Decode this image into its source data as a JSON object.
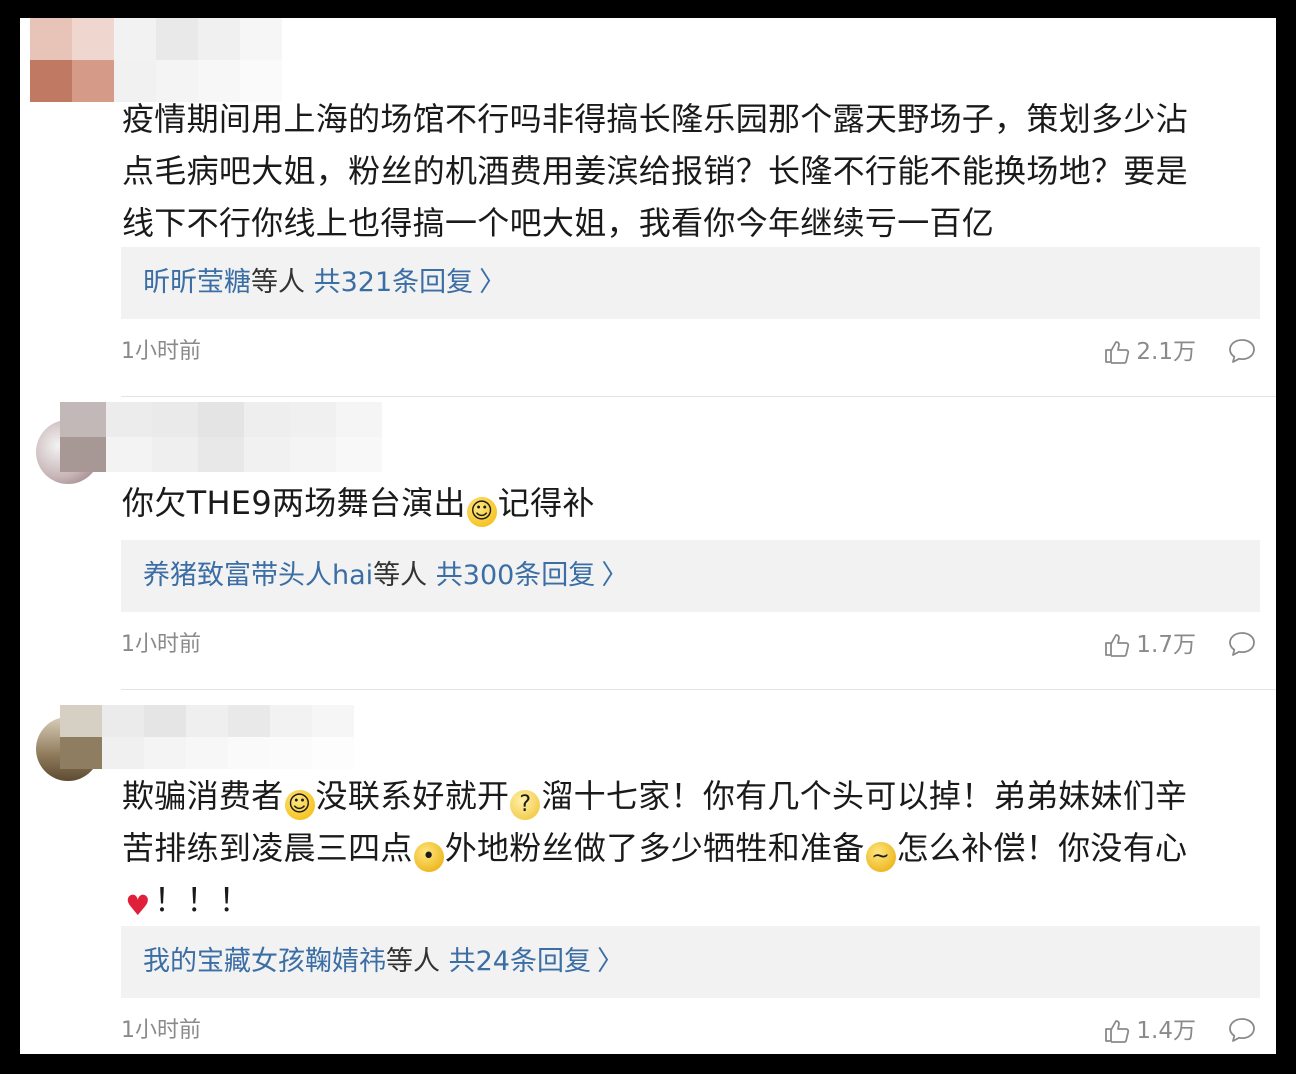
{
  "comments": [
    {
      "text_lines": [
        "疫情期间用上海的场馆不行吗非得搞长隆乐园那个露天野场子，策划多少沾",
        "点毛病吧大姐，粉丝的机酒费用姜滨给报销？长隆不行能不能换场地？要是",
        "线下不行你线上也得搞一个吧大姐，我看你今年继续亏一百亿"
      ],
      "reply_user": "昕昕莹糖",
      "reply_suffix": "等人",
      "reply_count": "共321条回复",
      "time": "1小时前",
      "likes": "2.1万"
    },
    {
      "text_a": "你欠THE9两场舞台演出",
      "text_b": "记得补",
      "reply_user": "养猪致富带头人hai",
      "reply_suffix": "等人",
      "reply_count": "共300条回复",
      "time": "1小时前",
      "likes": "1.7万"
    },
    {
      "text_1a": "欺骗消费者",
      "text_1b": "没联系好就开",
      "text_1c": "溜十七家！你有几个头可以掉！弟弟妹妹们辛",
      "text_2a": "苦排练到凌晨三四点",
      "text_2b": "外地粉丝做了多少牺牲和准备",
      "text_2c": "怎么补偿！你没有心",
      "text_3": "！！！",
      "reply_user": "我的宝藏女孩鞠婧祎",
      "reply_suffix": "等人",
      "reply_count": "共24条回复",
      "time": "1小时前",
      "likes": "1.4万"
    }
  ],
  "icons": {
    "like": "thumbs-up-icon",
    "reply": "comment-bubble-icon",
    "chevron": "chevron-right-icon",
    "emoji_smile": "smile-emoji-icon",
    "emoji_think": "thinking-emoji-icon",
    "emoji_roll": "eye-roll-emoji-icon",
    "emoji_cry": "crying-emoji-icon",
    "emoji_heart": "broken-heart-icon"
  },
  "colors": {
    "link": "#3b6ea5",
    "text": "#1a1a1a",
    "meta": "#8a8a8a",
    "reply_bg": "#f2f2f2"
  }
}
